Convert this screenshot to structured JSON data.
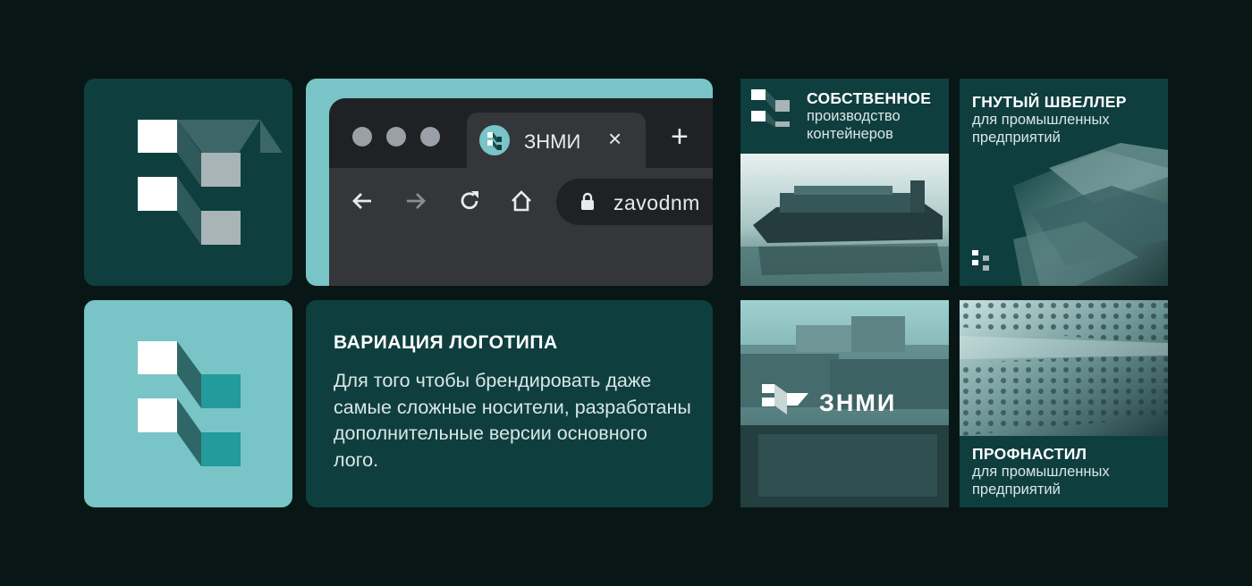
{
  "browser": {
    "tab_title": "ЗНМИ",
    "tab_close": "×",
    "new_tab": "+",
    "url": "zavodnm"
  },
  "description": {
    "title": "ВАРИАЦИЯ ЛОГОТИПА",
    "body": "Для того чтобы брендировать даже самые сложные носители, разработаны дополнительные версии основного лого."
  },
  "tiles": [
    {
      "title": "СОБСТВЕННОЕ",
      "subtitle_line1": "производство",
      "subtitle_line2": "контейнеров"
    },
    {
      "title": "ГНУТЫЙ ШВЕЛЛЕР",
      "subtitle_line1": "для промышленных",
      "subtitle_line2": "предприятий"
    },
    {
      "brand": "ЗНМИ"
    },
    {
      "title": "ПРОФНАСТИЛ",
      "subtitle_line1": "для промышленных",
      "subtitle_line2": "предприятий"
    }
  ],
  "colors": {
    "background": "#081716",
    "dark_teal": "#0f3e3f",
    "light_teal": "#78c4c7",
    "accent_teal": "#239a9c",
    "browser_dark": "#202124",
    "browser_tab": "#35363a"
  }
}
